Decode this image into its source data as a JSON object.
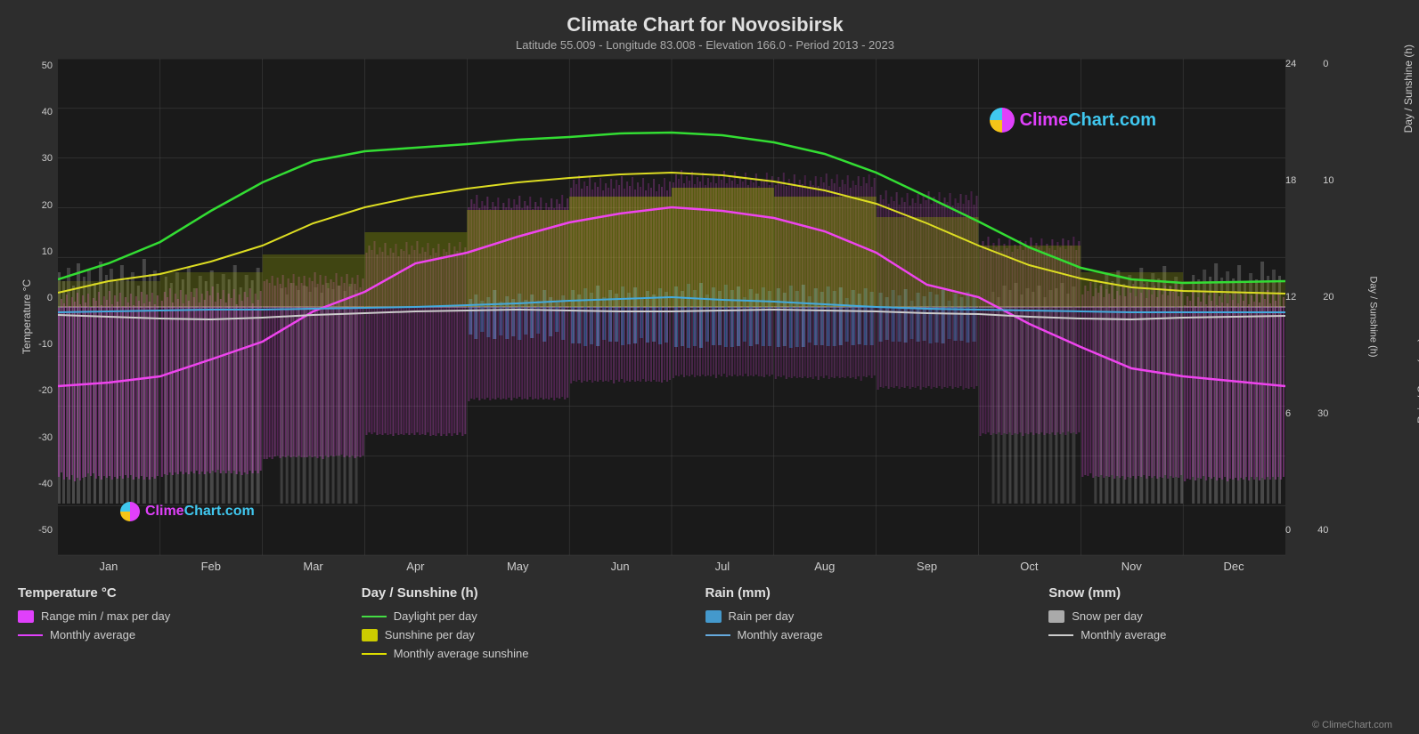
{
  "title": "Climate Chart for Novosibirsk",
  "subtitle": "Latitude 55.009 - Longitude 83.008 - Elevation 166.0 - Period 2013 - 2023",
  "watermark": "ClimeChart.com",
  "copyright": "© ClimeChart.com",
  "y_axis_left_label": "Temperature °C",
  "y_axis_right_label1": "Day / Sunshine (h)",
  "y_axis_right_label2": "Rain / Snow (mm)",
  "y_ticks_left": [
    "50",
    "40",
    "30",
    "20",
    "10",
    "0",
    "-10",
    "-20",
    "-30",
    "-40",
    "-50"
  ],
  "y_ticks_right_sunshine": [
    "24",
    "18",
    "12",
    "6",
    "0"
  ],
  "y_ticks_right_rain": [
    "0",
    "10",
    "20",
    "30",
    "40"
  ],
  "x_months": [
    "Jan",
    "Feb",
    "Mar",
    "Apr",
    "May",
    "Jun",
    "Jul",
    "Aug",
    "Sep",
    "Oct",
    "Nov",
    "Dec"
  ],
  "legend": {
    "col1_title": "Temperature °C",
    "col1_items": [
      {
        "type": "swatch",
        "color": "#e040fb",
        "label": "Range min / max per day"
      },
      {
        "type": "line",
        "color": "#e040fb",
        "label": "Monthly average"
      }
    ],
    "col2_title": "Day / Sunshine (h)",
    "col2_items": [
      {
        "type": "line",
        "color": "#44dd44",
        "label": "Daylight per day"
      },
      {
        "type": "swatch",
        "color": "#cccc00",
        "label": "Sunshine per day"
      },
      {
        "type": "line",
        "color": "#dddd00",
        "label": "Monthly average sunshine"
      }
    ],
    "col3_title": "Rain (mm)",
    "col3_items": [
      {
        "type": "swatch",
        "color": "#4499cc",
        "label": "Rain per day"
      },
      {
        "type": "line",
        "color": "#66aadd",
        "label": "Monthly average"
      }
    ],
    "col4_title": "Snow (mm)",
    "col4_items": [
      {
        "type": "swatch",
        "color": "#aaaaaa",
        "label": "Snow per day"
      },
      {
        "type": "line",
        "color": "#cccccc",
        "label": "Monthly average"
      }
    ]
  }
}
